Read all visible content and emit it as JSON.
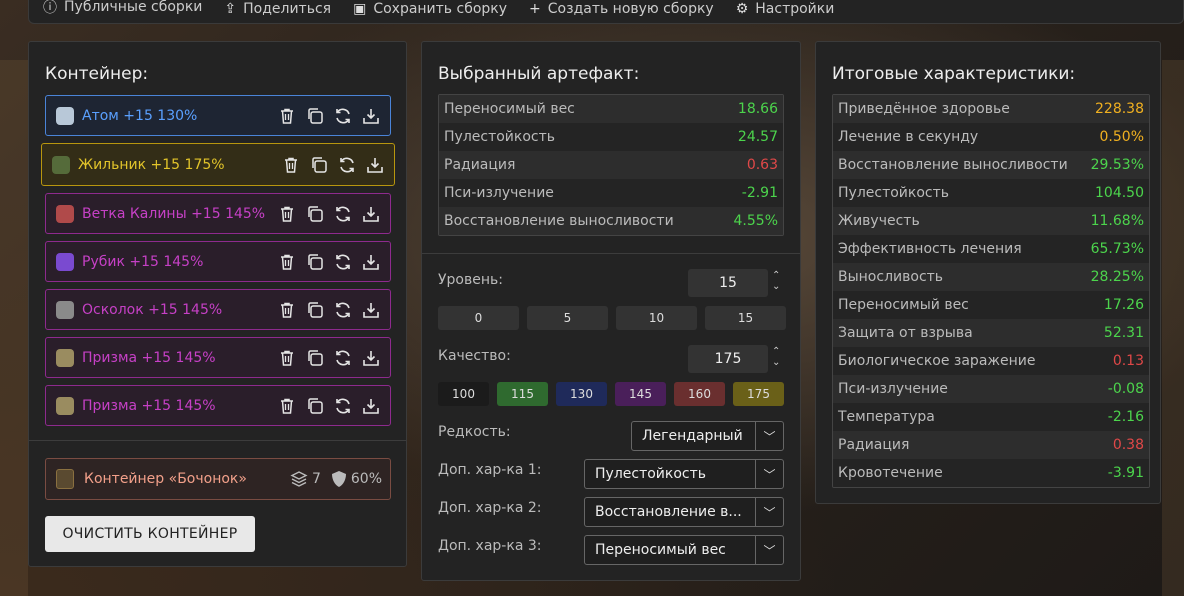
{
  "nav": [
    {
      "label": "Публичные сборки",
      "icon": "info-icon"
    },
    {
      "label": "Поделиться",
      "icon": "share-icon"
    },
    {
      "label": "Сохранить сборку",
      "icon": "save-icon"
    },
    {
      "label": "Создать новую сборку",
      "icon": "plus-icon"
    },
    {
      "label": "Настройки",
      "icon": "gear-icon"
    }
  ],
  "container": {
    "title": "Контейнер:",
    "artifacts": [
      {
        "name": "Атом +15 130%",
        "color": "#5aa0ff",
        "border": "#4a84d8",
        "bg": "#1e2533",
        "icon_color": "#b8c8d8"
      },
      {
        "name": "Жильник +15 175%",
        "color": "#e2c42a",
        "border": "#b8960e",
        "bg": "#332d17",
        "icon_color": "#556b3a"
      },
      {
        "name": "Ветка Калины +15 145%",
        "color": "#c640c6",
        "border": "#8e2a8e",
        "bg": "#2a1e2a",
        "icon_color": "#b04a4a"
      },
      {
        "name": "Рубик +15 145%",
        "color": "#c640c6",
        "border": "#8e2a8e",
        "bg": "#2a1e2a",
        "icon_color": "#7a4ad0"
      },
      {
        "name": "Осколок +15 145%",
        "color": "#c640c6",
        "border": "#8e2a8e",
        "bg": "#2a1e2a",
        "icon_color": "#8a8a8a"
      },
      {
        "name": "Призма +15 145%",
        "color": "#c640c6",
        "border": "#8e2a8e",
        "bg": "#2a1e2a",
        "icon_color": "#9a8c60"
      },
      {
        "name": "Призма +15 145%",
        "color": "#c640c6",
        "border": "#8e2a8e",
        "bg": "#2a1e2a",
        "icon_color": "#9a8c60"
      }
    ],
    "container_item": {
      "name": "Контейнер «Бочонок»",
      "slots": "7",
      "protection": "60%"
    },
    "clear_button": "ОЧИСТИТЬ КОНТЕЙНЕР"
  },
  "selected": {
    "title": "Выбранный артефакт:",
    "stats": [
      {
        "name": "Переносимый вес",
        "value": "18.66",
        "tone": "green"
      },
      {
        "name": "Пулестойкость",
        "value": "24.57",
        "tone": "green"
      },
      {
        "name": "Радиация",
        "value": "0.63",
        "tone": "red"
      },
      {
        "name": "Пси-излучение",
        "value": "-2.91",
        "tone": "green"
      },
      {
        "name": "Восстановление выносливости",
        "value": "4.55%",
        "tone": "green"
      }
    ],
    "level_label": "Уровень:",
    "level_value": "15",
    "level_quick": [
      "0",
      "5",
      "10",
      "15"
    ],
    "quality_label": "Качество:",
    "quality_value": "175",
    "quality_quick": [
      {
        "label": "100",
        "bg": "#1b1b1b"
      },
      {
        "label": "115",
        "bg": "#2f6a2f"
      },
      {
        "label": "130",
        "bg": "#1f2a5a"
      },
      {
        "label": "145",
        "bg": "#4a1f5a"
      },
      {
        "label": "160",
        "bg": "#6a2f2f"
      },
      {
        "label": "175",
        "bg": "#6a6018"
      }
    ],
    "rarity_label": "Редкость:",
    "rarity_value": "Легендарный",
    "extra1_label": "Доп. хар-ка 1:",
    "extra1_value": "Пулестойкость",
    "extra2_label": "Доп. хар-ка 2:",
    "extra2_value": "Восстановление в...",
    "extra3_label": "Доп. хар-ка 3:",
    "extra3_value": "Переносимый вес"
  },
  "totals": {
    "title": "Итоговые характеристики:",
    "stats": [
      {
        "name": "Приведённое здоровье",
        "value": "228.38",
        "tone": "yellow"
      },
      {
        "name": "Лечение в секунду",
        "value": "0.50%",
        "tone": "yellow"
      },
      {
        "name": "Восстановление выносливости",
        "value": "29.53%",
        "tone": "green"
      },
      {
        "name": "Пулестойкость",
        "value": "104.50",
        "tone": "green"
      },
      {
        "name": "Живучесть",
        "value": "11.68%",
        "tone": "green"
      },
      {
        "name": "Эффективность лечения",
        "value": "65.73%",
        "tone": "green"
      },
      {
        "name": "Выносливость",
        "value": "28.25%",
        "tone": "green"
      },
      {
        "name": "Переносимый вес",
        "value": "17.26",
        "tone": "green"
      },
      {
        "name": "Защита от взрыва",
        "value": "52.31",
        "tone": "green"
      },
      {
        "name": "Биологическое заражение",
        "value": "0.13",
        "tone": "red"
      },
      {
        "name": "Пси-излучение",
        "value": "-0.08",
        "tone": "green"
      },
      {
        "name": "Температура",
        "value": "-2.16",
        "tone": "green"
      },
      {
        "name": "Радиация",
        "value": "0.38",
        "tone": "red"
      },
      {
        "name": "Кровотечение",
        "value": "-3.91",
        "tone": "green"
      }
    ]
  }
}
